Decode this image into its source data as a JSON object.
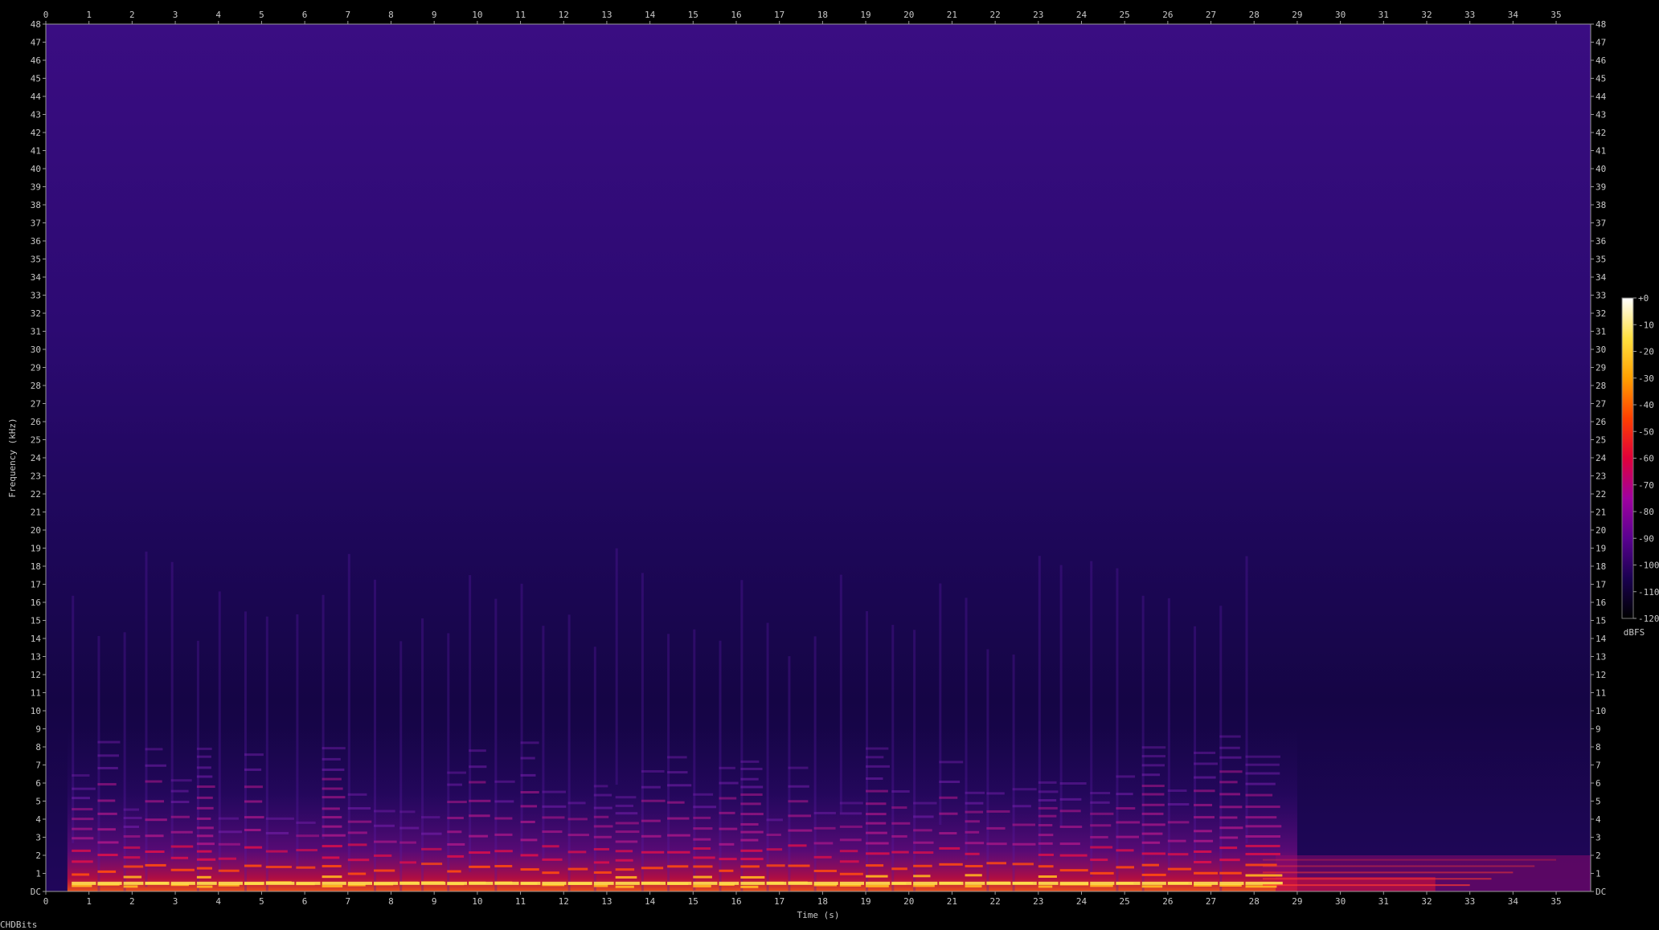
{
  "watermark": "CHDBits",
  "chart_data": {
    "type": "heatmap",
    "xlabel": "Time (s)",
    "ylabel": "Frequency (kHz)",
    "xlim": [
      0,
      35.8
    ],
    "ylim": [
      0,
      48
    ],
    "x_ticks": [
      "0",
      "1",
      "2",
      "3",
      "4",
      "5",
      "6",
      "7",
      "8",
      "9",
      "10",
      "11",
      "12",
      "13",
      "14",
      "15",
      "16",
      "17",
      "18",
      "19",
      "20",
      "21",
      "22",
      "23",
      "24",
      "25",
      "26",
      "27",
      "28",
      "29",
      "30",
      "31",
      "32",
      "33",
      "34",
      "35"
    ],
    "y_ticks": [
      "DC",
      "1",
      "2",
      "3",
      "4",
      "5",
      "6",
      "7",
      "8",
      "9",
      "10",
      "11",
      "12",
      "13",
      "14",
      "15",
      "16",
      "17",
      "18",
      "19",
      "20",
      "21",
      "22",
      "23",
      "24",
      "25",
      "26",
      "27",
      "28",
      "29",
      "30",
      "31",
      "32",
      "33",
      "34",
      "35",
      "36",
      "37",
      "38",
      "39",
      "40",
      "41",
      "42",
      "43",
      "44",
      "45",
      "46",
      "47",
      "48"
    ],
    "colorbar": {
      "label": "dBFS",
      "ticks": [
        "+0",
        "-10",
        "-20",
        "-30",
        "-40",
        "-50",
        "-60",
        "-70",
        "-80",
        "-90",
        "-100",
        "-110",
        "-120"
      ],
      "range": [
        -120,
        0
      ],
      "colors": [
        "#000000",
        "#1a0050",
        "#5a0090",
        "#a000a0",
        "#e0003a",
        "#ff4000",
        "#ffa000",
        "#ffe040",
        "#ffffff"
      ]
    },
    "note_onsets_s": [
      0.6,
      1.2,
      1.8,
      2.3,
      2.9,
      3.5,
      4.0,
      4.6,
      5.1,
      5.8,
      6.4,
      7.0,
      7.6,
      8.2,
      8.7,
      9.3,
      9.8,
      10.4,
      11.0,
      11.5,
      12.1,
      12.7,
      13.2,
      13.8,
      14.4,
      15.0,
      15.6,
      16.1,
      16.7,
      17.2,
      17.8,
      18.4,
      19.0,
      19.6,
      20.1,
      20.7,
      21.3,
      21.8,
      22.4,
      23.0,
      23.5,
      24.2,
      24.8,
      25.4,
      26.0,
      26.6,
      27.2,
      27.8
    ]
  }
}
